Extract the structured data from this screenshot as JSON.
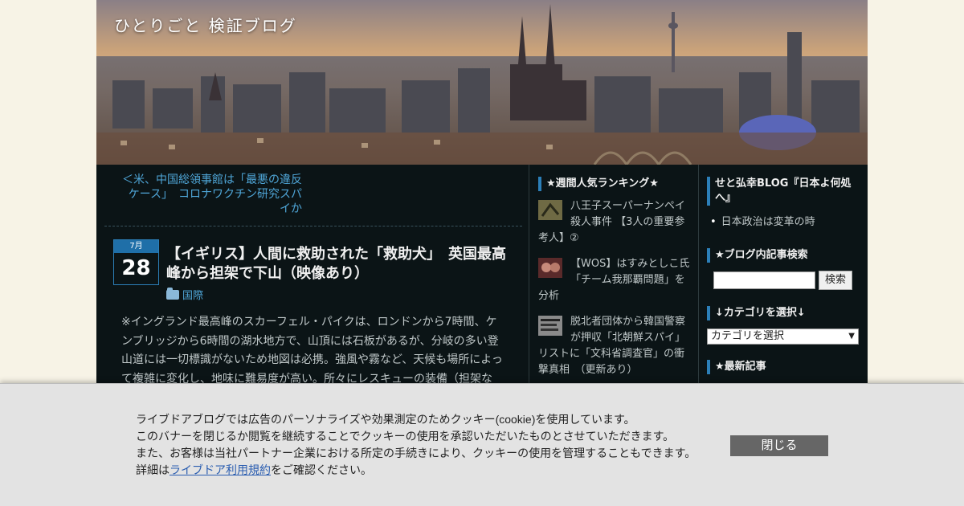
{
  "header": {
    "blog_title": "ひとりごと 検証ブログ"
  },
  "main": {
    "prev_link": "＜米、中国総領事館は「最悪の違反ケース」　コロナワクチン研究スパイか",
    "date": {
      "month": "7月",
      "day": "28"
    },
    "post_title": "【イギリス】人間に救助された「救助犬」　英国最高峰から担架で下山（映像あり）",
    "category": "国際",
    "body": "※イングランド最高峰のスカーフェル・パイクは、ロンドンから7時間、ケンブリッジから6時間の湖水地方で、山頂には石板があるが、分岐の多い登山道には一切標識がないため地図は必携。強風や霧など、天候も場所によって複雑に変化し、地味に難易度が高い。所々にレスキューの装備（担架な"
  },
  "ranking": {
    "heading": "★週間人気ランキング★",
    "items": [
      {
        "text": "八王子スーパーナンペイ殺人事件 【3人の重要参考人】②"
      },
      {
        "text": "【WOS】はすみとしこ氏「チーム我那覇問題」を分析"
      },
      {
        "text": "脱北者団体から韓国警察が押収「北朝鮮スパイ」リストに「文科省調査官」の衝撃真相　（更新あり）"
      }
    ]
  },
  "sidebar": {
    "link_heading": "せと弘幸BLOG『日本よ何処へ』",
    "link_item": "日本政治は変革の時",
    "search_heading": "★ブログ内記事検索",
    "search_button": "検索",
    "category_heading": "↓カテゴリを選択↓",
    "category_select": "カテゴリを選択",
    "latest_heading": "★最新記事"
  },
  "cookie": {
    "line1": "ライブドアブログでは広告のパーソナライズや効果測定のためクッキー(cookie)を使用しています。",
    "line2": "このバナーを閉じるか閲覧を継続することでクッキーの使用を承認いただいたものとさせていただきます。",
    "line3": "また、お客様は当社パートナー企業における所定の手続きにより、クッキーの使用を管理することもできます。",
    "line4_prefix": "詳細は",
    "line4_link": "ライブドア利用規約",
    "line4_suffix": "をご確認ください。",
    "close_button": "閉じる"
  }
}
